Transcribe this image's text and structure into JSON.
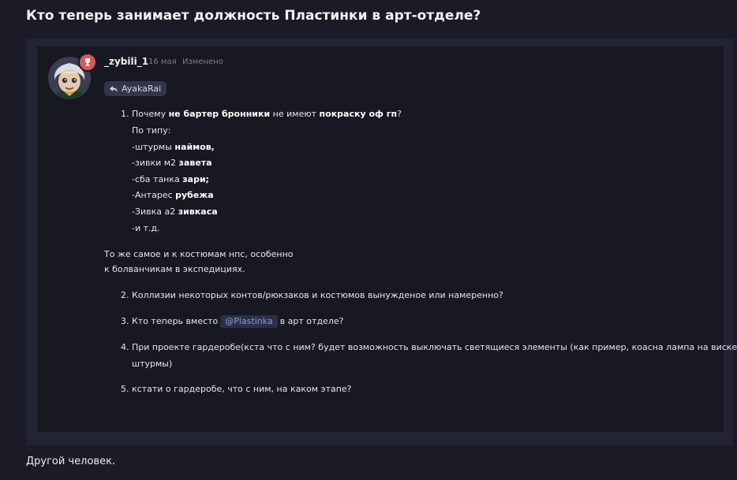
{
  "page_title": "Кто теперь занимает должность Пластинки в арт-отделе?",
  "message": {
    "username": "_zybili_1",
    "date": "16 мая",
    "edited": "Изменено",
    "reply_to": "AyakaRai",
    "item1_num": "1.",
    "item1_a": "Почему ",
    "item1_b": "не бартер бронники",
    "item1_c": " не имеют ",
    "item1_d": "покраску оф гп",
    "item1_e": "?",
    "line_po_tipu": "По типу:",
    "sub1_a": "-штурмы ",
    "sub1_b": "наймов,",
    "sub2_a": "-зивки м2 ",
    "sub2_b": "завета",
    "sub3_a": "-сба танка ",
    "sub3_b": "зари;",
    "sub4_a": "-Антарес ",
    "sub4_b": "рубежа",
    "sub5_a": "-Зивка а2 ",
    "sub5_b": "зивкаса",
    "sub6": "-и т.д.",
    "para1": "То же самое и к костюмам нпс, особенно",
    "para2": "к болванчикам в экспедициях.",
    "item2": "2. Коллизии некоторых контов/рюкзаков и костюмов вынужденое или намеренно?",
    "item3_a": "3. Кто теперь вместо",
    "item3_mention": "@Plastinka",
    "item3_b": "в арт отделе?",
    "item4_a": "4. При проекте гардеробе(кста что с ним? будет возможность выключать светящиеся элементы (как пример, коасна лампа на виске у",
    "item4_b": "штурмы)",
    "item5": "5. кстати о гардеробе, что с ним, на каком этапе?"
  },
  "footer": "Другой человек.",
  "colors": {
    "background": "#1a1b26",
    "card": "#222333",
    "inner": "#171822",
    "mention": "#8c99d6",
    "role_badge": "#d65a5a"
  },
  "icons": {
    "reply": "reply-arrow-icon",
    "role": "trophy-icon",
    "avatar": "user-avatar"
  }
}
